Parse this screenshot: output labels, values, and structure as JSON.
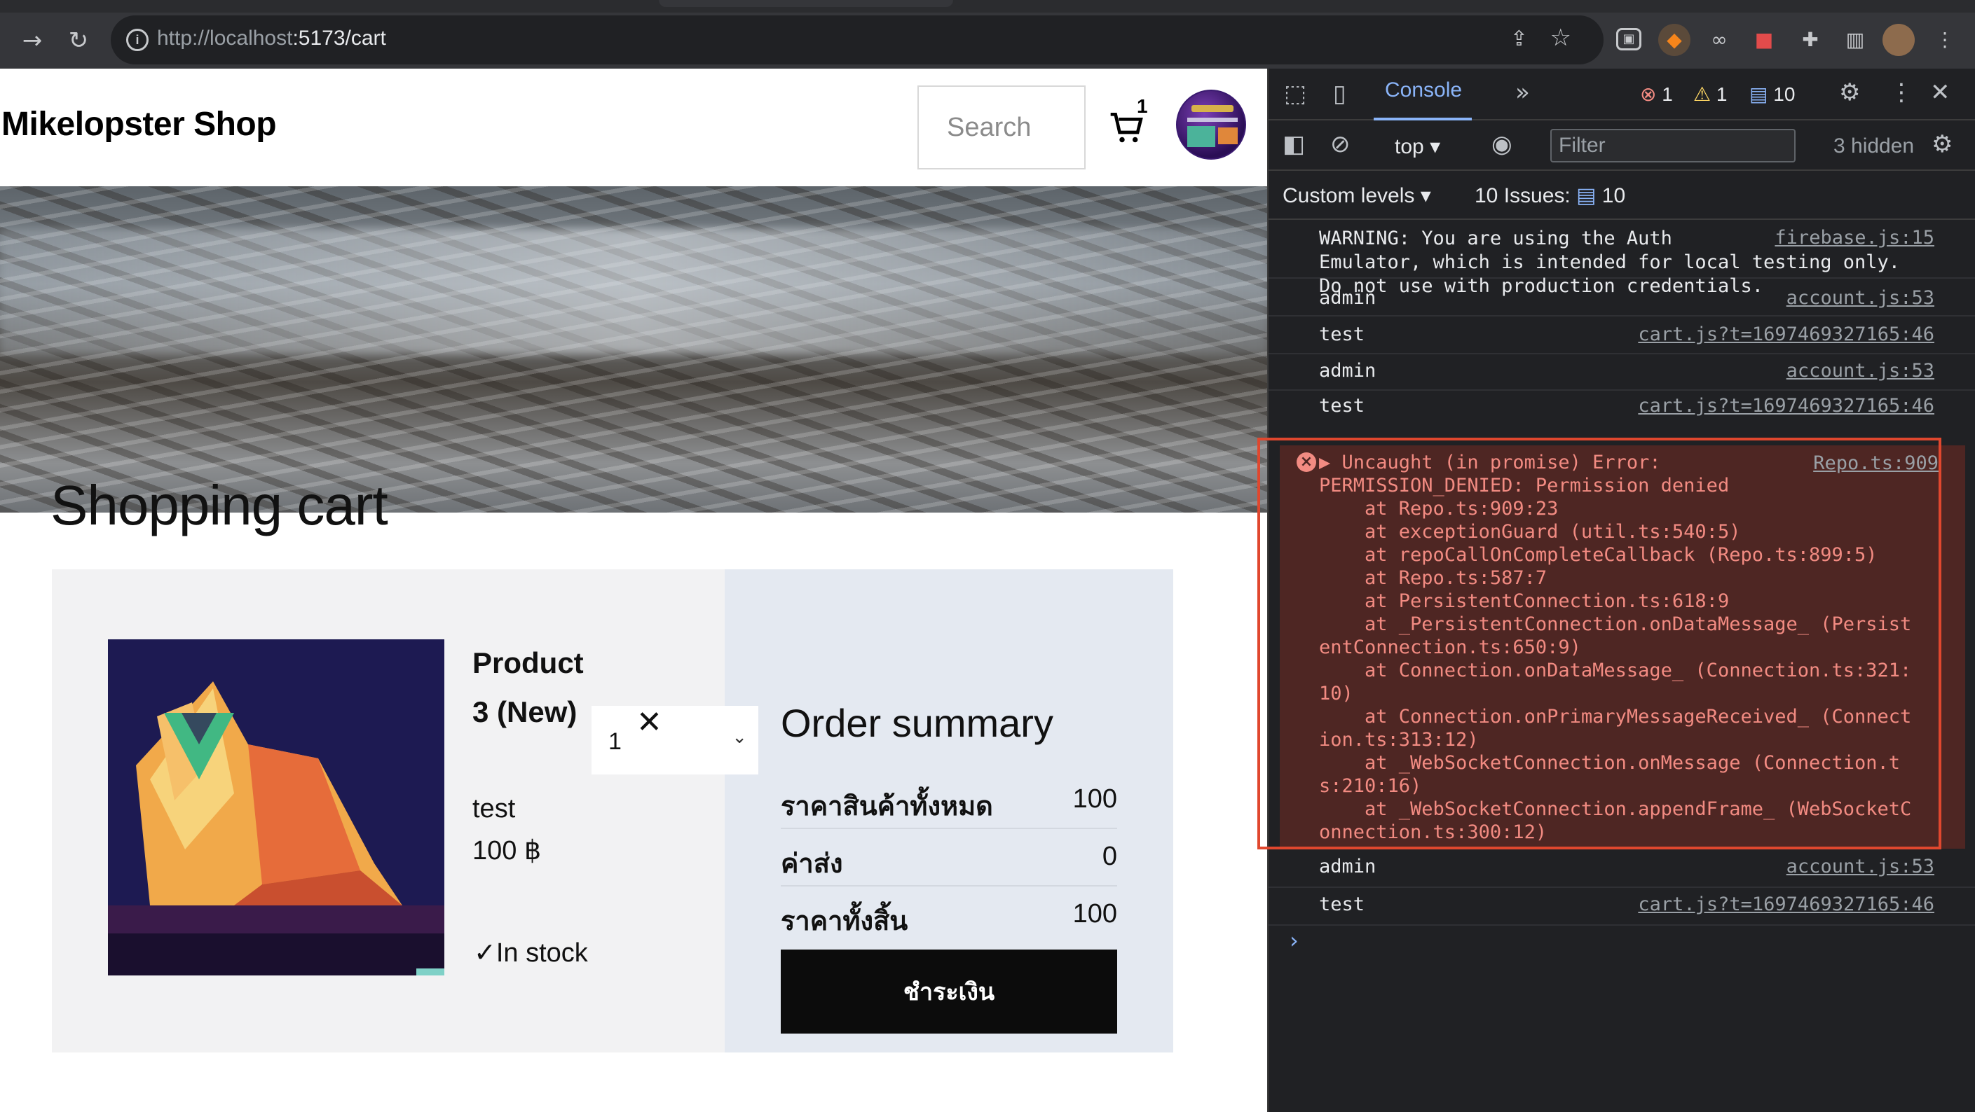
{
  "browser": {
    "url_host": "http://localhost",
    "url_rest": ":5173/cart"
  },
  "shop": {
    "title": "Mikelopster Shop",
    "search_placeholder": "Search",
    "cart_count": "1"
  },
  "cart": {
    "heading": "Shopping cart",
    "item": {
      "name": "Product 3 (New)",
      "variant": "test",
      "price": "100 ฿",
      "quantity": "1",
      "stock": "In stock"
    }
  },
  "summary": {
    "title": "Order summary",
    "rows": [
      {
        "label": "ราคาสินค้าทั้งหมด",
        "value": "100"
      },
      {
        "label": "ค่าส่ง",
        "value": "0"
      },
      {
        "label": "ราคาทั้งสิ้น",
        "value": "100"
      }
    ],
    "pay_label": "ชำระเงิน"
  },
  "devtools": {
    "active_tab": "Console",
    "error_count": "1",
    "warning_count": "1",
    "info_count": "10",
    "context": "top",
    "filter_placeholder": "Filter",
    "hidden": "3 hidden",
    "levels": "Custom levels",
    "issues_label": "10 Issues:",
    "issues_count": "10",
    "logs": [
      {
        "msg": "WARNING: You are using the Auth\nEmulator, which is intended for local testing only.\nDo not use with production credentials.",
        "src": "firebase.js:15"
      },
      {
        "msg": "admin",
        "src": "account.js:53"
      },
      {
        "msg": "test",
        "src": "cart.js?t=1697469327165:46"
      },
      {
        "msg": "admin",
        "src": "account.js:53"
      },
      {
        "msg": "test",
        "src": "cart.js?t=1697469327165:46"
      },
      {
        "msg": "admin",
        "src": "account.js:53"
      },
      {
        "msg": "test",
        "src": "cart.js?t=1697469327165:46"
      }
    ],
    "error": {
      "src": "Repo.ts:909",
      "lines": [
        "▶ Uncaught (in promise) Error:",
        "PERMISSION_DENIED: Permission denied",
        "    at Repo.ts:909:23",
        "    at exceptionGuard (util.ts:540:5)",
        "    at repoCallOnCompleteCallback (Repo.ts:899:5)",
        "    at Repo.ts:587:7",
        "    at PersistentConnection.ts:618:9",
        "    at _PersistentConnection.onDataMessage_ (Persist",
        "entConnection.ts:650:9)",
        "    at Connection.onDataMessage_ (Connection.ts:321:",
        "10)",
        "    at Connection.onPrimaryMessageReceived_ (Connect",
        "ion.ts:313:12)",
        "    at _WebSocketConnection.onMessage (Connection.t",
        "s:210:16)",
        "    at _WebSocketConnection.appendFrame_ (WebSocketC",
        "onnection.ts:300:12)"
      ]
    }
  }
}
